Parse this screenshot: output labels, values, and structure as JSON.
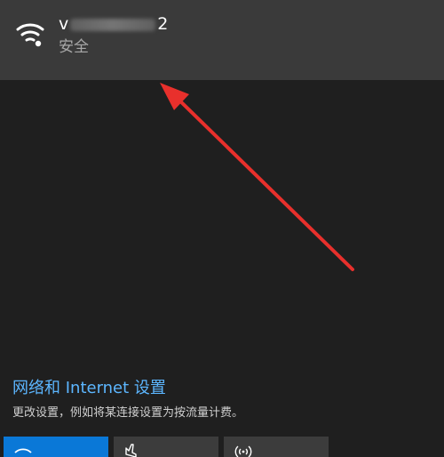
{
  "network": {
    "ssid_prefix": "v",
    "ssid_suffix": "2",
    "status": "安全"
  },
  "settings": {
    "title": "网络和 Internet 设置",
    "description": "更改设置，例如将某连接设置为按流量计费。"
  },
  "quick_actions": [
    {
      "name": "WLAN",
      "icon": "wifi-icon",
      "active": true
    },
    {
      "name": "Airplane mode",
      "icon": "airplane-icon",
      "active": false
    },
    {
      "name": "Mobile hotspot",
      "icon": "hotspot-icon",
      "active": false
    }
  ],
  "colors": {
    "background": "#1f1f1f",
    "selected_row": "#3a3a3a",
    "link": "#5cb6ff",
    "accent": "#0a78d7",
    "annotation_arrow": "#e8302c"
  }
}
